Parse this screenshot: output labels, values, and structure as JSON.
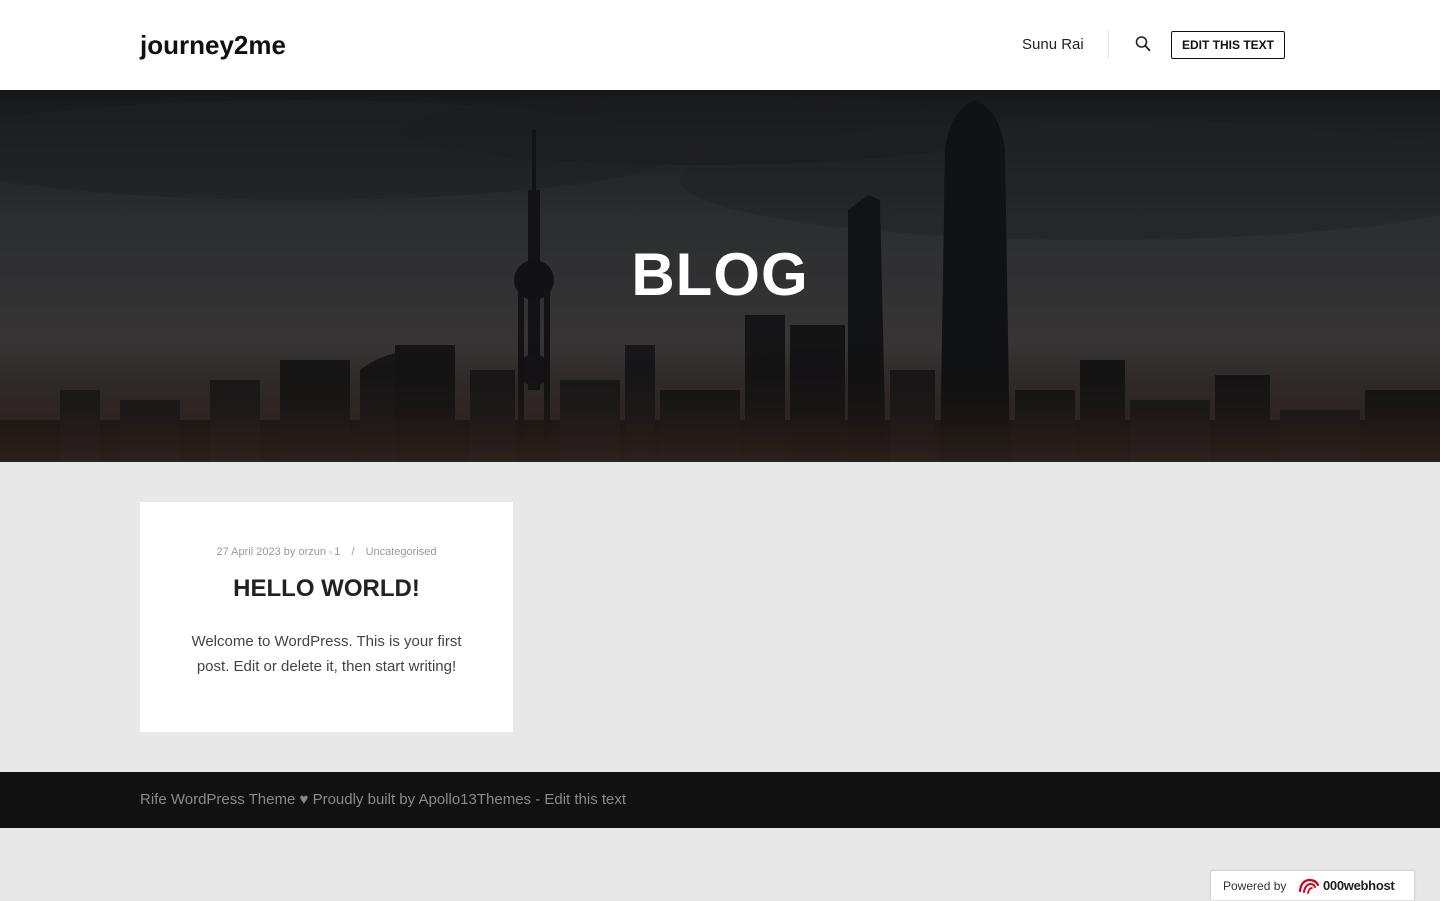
{
  "header": {
    "logo": "journey2me",
    "user_name": "Sunu Rai",
    "search_icon": "search-icon",
    "button_label": "EDIT THIS TEXT"
  },
  "hero": {
    "title": "BLOG"
  },
  "post": {
    "date": "27 April 2023",
    "by_label": "by",
    "author": "orzun",
    "comment_icon": "comment-icon",
    "comment_count": "1",
    "separator": "/",
    "category": "Uncategorised",
    "title": "HELLO WORLD!",
    "excerpt": "Welcome to WordPress. This is your first post. Edit or delete it, then start writing!"
  },
  "footer": {
    "text": "Rife WordPress Theme ♥ Proudly built by Apollo13Themes - Edit this text"
  },
  "badge": {
    "label": "Powered by",
    "brand": "000webhost",
    "brand_icon": "000webhost-logo-icon"
  },
  "colors": {
    "header_bg": "#ffffff",
    "page_bg": "#e8e8e8",
    "footer_bg": "#111111",
    "brand_accent": "#d0021b"
  }
}
